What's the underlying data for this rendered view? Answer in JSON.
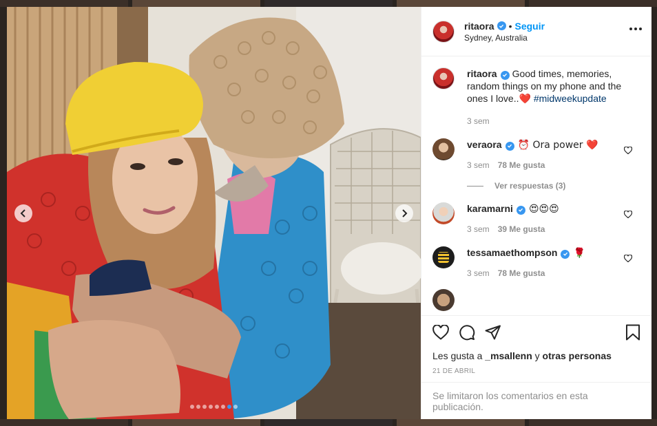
{
  "post": {
    "author": "ritaora",
    "follow_label": "Seguir",
    "separator": "•",
    "location": "Sydney, Australia",
    "caption_prefix": "Good times, memories, random things on my phone and the ones I love..",
    "caption_emoji": "❤️",
    "hashtag": "#midweekupdate",
    "caption_time": "3 sem",
    "liked_by_prefix": "Les gusta a",
    "liked_by_user": "_msallenn",
    "liked_by_joiner": "y",
    "liked_by_others": "otras personas",
    "date": "21 DE ABRIL",
    "comments_disabled": "Se limitaron los comentarios en esta publicación."
  },
  "carousel": {
    "total": 8,
    "active_index": 6
  },
  "comments": [
    {
      "user": "veraora",
      "verified": true,
      "text": "⏰ Ora power ❤️",
      "time": "3 sem",
      "likes": "78 Me gusta"
    },
    {
      "user": "karamarni",
      "verified": true,
      "text": "😍😍😍",
      "time": "3 sem",
      "likes": "39 Me gusta"
    },
    {
      "user": "tessamaethompson",
      "verified": true,
      "text": "🌹",
      "time": "3 sem",
      "likes": "78 Me gusta"
    }
  ],
  "replies_label": "Ver respuestas (3)",
  "icons": {
    "prev": "chevron-left-icon",
    "next": "chevron-right-icon",
    "like": "heart-icon",
    "comment": "comment-bubble-icon",
    "share": "paper-plane-icon",
    "save": "bookmark-icon",
    "more": "more-options-icon"
  },
  "colors": {
    "verified": "#3897f0",
    "follow": "#0095f6",
    "hashtag": "#00376b",
    "heart": "#ed4956"
  }
}
